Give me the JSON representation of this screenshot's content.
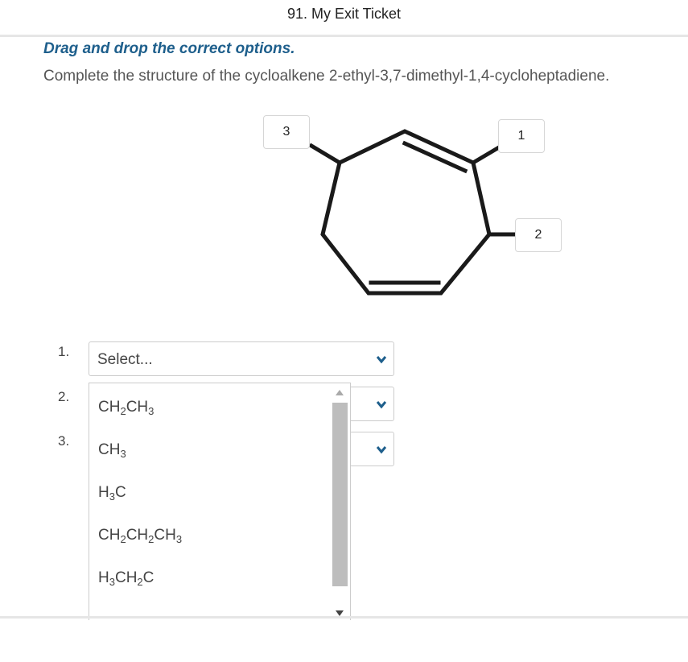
{
  "header": {
    "title": "91. My Exit Ticket"
  },
  "prompt": {
    "instruction": "Drag and drop the correct options.",
    "question": "Complete the structure of the cycloalkene 2-ethyl-3,7-dimethyl-1,4-cycloheptadiene."
  },
  "drop_labels": [
    "3",
    "1",
    "2"
  ],
  "rows": [
    {
      "number": "1.",
      "value": "Select..."
    },
    {
      "number": "2.",
      "value": ""
    },
    {
      "number": "3.",
      "value": ""
    }
  ],
  "dropdown": {
    "options": [
      {
        "parts": [
          "CH",
          "2",
          "CH",
          "3"
        ]
      },
      {
        "parts": [
          "CH",
          "3"
        ]
      },
      {
        "parts": [
          "H",
          "3",
          "C"
        ]
      },
      {
        "parts": [
          "CH",
          "2",
          "CH",
          "2",
          "CH",
          "3"
        ]
      },
      {
        "parts": [
          "H",
          "3",
          "CH",
          "2",
          "C"
        ]
      }
    ]
  },
  "colors": {
    "accent": "#1e5f8c",
    "bond": "#1a1a1a",
    "scroll_thumb": "#bdbdbd"
  }
}
